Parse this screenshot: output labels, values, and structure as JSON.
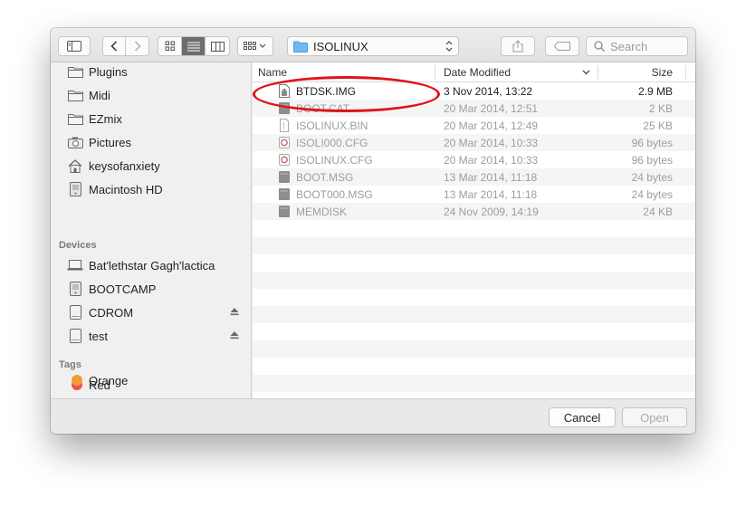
{
  "toolbar": {
    "location": "ISOLINUX",
    "search_placeholder": "Search"
  },
  "sidebar": {
    "favorites": [
      {
        "label": "Plugins",
        "icon": "folder-icon"
      },
      {
        "label": "Midi",
        "icon": "folder-icon"
      },
      {
        "label": "EZmix",
        "icon": "folder-icon"
      },
      {
        "label": "Pictures",
        "icon": "camera-icon"
      },
      {
        "label": "keysofanxiety",
        "icon": "home-icon"
      },
      {
        "label": "Macintosh HD",
        "icon": "hard-drive-icon"
      }
    ],
    "devices_heading": "Devices",
    "devices": [
      {
        "label": "Bat'lethstar Gagh'lactica",
        "icon": "laptop-icon"
      },
      {
        "label": "BOOTCAMP",
        "icon": "hard-drive-icon"
      },
      {
        "label": "CDROM",
        "icon": "disk-icon"
      },
      {
        "label": "test",
        "icon": "disk-icon"
      }
    ],
    "tags_heading": "Tags",
    "tags": [
      {
        "label": "Red",
        "color": "#f2504f"
      },
      {
        "label": "Orange",
        "color": "#f59a3a"
      }
    ]
  },
  "list": {
    "columns": {
      "name": "Name",
      "date": "Date Modified",
      "size": "Size"
    },
    "files": [
      {
        "name": "BTDSK.IMG",
        "date": "3 Nov 2014, 13:22",
        "size": "2.9 MB",
        "icon": "disk-image-icon",
        "enabled": true
      },
      {
        "name": "BOOT.CAT",
        "date": "20 Mar 2014, 12:51",
        "size": "2 KB",
        "icon": "file-icon",
        "enabled": false
      },
      {
        "name": "ISOLINUX.BIN",
        "date": "20 Mar 2014, 12:49",
        "size": "25 KB",
        "icon": "binary-file-icon",
        "enabled": false
      },
      {
        "name": "ISOLI000.CFG",
        "date": "20 Mar 2014, 10:33",
        "size": "96 bytes",
        "icon": "config-file-icon",
        "enabled": false
      },
      {
        "name": "ISOLINUX.CFG",
        "date": "20 Mar 2014, 10:33",
        "size": "96 bytes",
        "icon": "config-file-icon",
        "enabled": false
      },
      {
        "name": "BOOT.MSG",
        "date": "13 Mar 2014, 11:18",
        "size": "24 bytes",
        "icon": "file-icon",
        "enabled": false
      },
      {
        "name": "BOOT000.MSG",
        "date": "13 Mar 2014, 11:18",
        "size": "24 bytes",
        "icon": "file-icon",
        "enabled": false
      },
      {
        "name": "MEMDISK",
        "date": "24 Nov 2009, 14:19",
        "size": "24 KB",
        "icon": "file-icon",
        "enabled": false
      }
    ]
  },
  "buttons": {
    "cancel": "Cancel",
    "open": "Open"
  },
  "colors": {
    "highlight_ring": "#e0141b",
    "folder_blue": "#6fb8f1"
  }
}
